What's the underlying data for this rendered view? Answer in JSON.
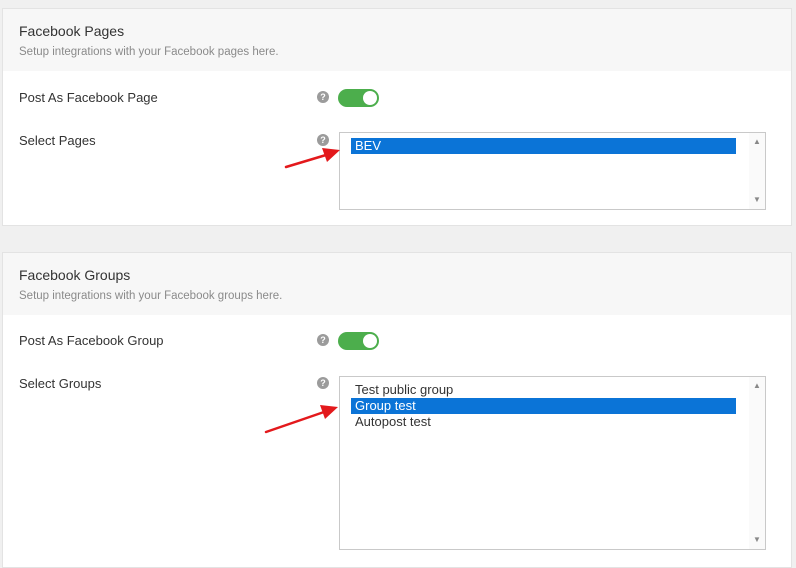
{
  "pages_section": {
    "title": "Facebook Pages",
    "description": "Setup integrations with your Facebook pages here.",
    "post_as_label": "Post As Facebook Page",
    "post_as_enabled": true,
    "select_label": "Select Pages",
    "options": [
      {
        "label": "BEV",
        "selected": true
      }
    ]
  },
  "groups_section": {
    "title": "Facebook Groups",
    "description": "Setup integrations with your Facebook groups here.",
    "post_as_label": "Post As Facebook Group",
    "post_as_enabled": true,
    "select_label": "Select Groups",
    "options": [
      {
        "label": "Test public group",
        "selected": false
      },
      {
        "label": "Group test",
        "selected": true
      },
      {
        "label": "Autopost test",
        "selected": false
      }
    ]
  },
  "icons": {
    "help": "?",
    "scroll_up": "▲",
    "scroll_down": "▼"
  },
  "colors": {
    "toggle_on": "#4cae4c",
    "selection": "#0b74d7",
    "annotation_arrow": "#e3191c"
  }
}
